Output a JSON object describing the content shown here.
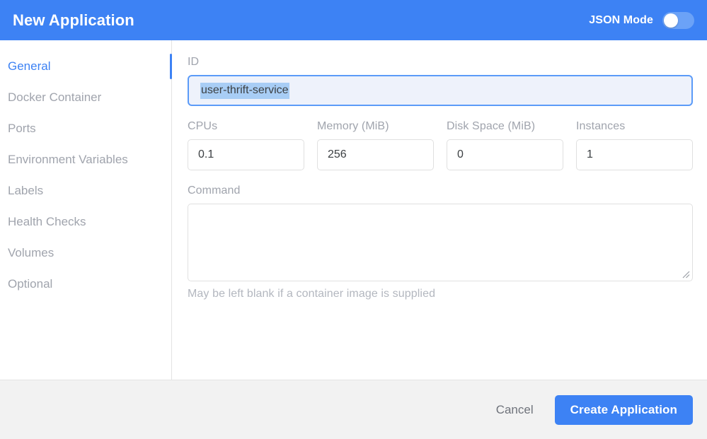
{
  "header": {
    "title": "New Application",
    "json_mode_label": "JSON Mode",
    "json_mode_on": false,
    "accent_color": "#3d82f4"
  },
  "sidebar": {
    "active_index": 0,
    "items": [
      {
        "label": "General"
      },
      {
        "label": "Docker Container"
      },
      {
        "label": "Ports"
      },
      {
        "label": "Environment Variables"
      },
      {
        "label": "Labels"
      },
      {
        "label": "Health Checks"
      },
      {
        "label": "Volumes"
      },
      {
        "label": "Optional"
      }
    ]
  },
  "form": {
    "id": {
      "label": "ID",
      "value": "user-thrift-service",
      "placeholder": "",
      "focused": true,
      "text_selected": true,
      "selection_color": "#a8cdf5",
      "focus_bg": "#eef2fb",
      "focus_border": "#5b9bf8"
    },
    "numeric_fields": [
      {
        "label": "CPUs",
        "value": "0.1",
        "placeholder": ""
      },
      {
        "label": "Memory (MiB)",
        "value": "256",
        "placeholder": ""
      },
      {
        "label": "Disk Space (MiB)",
        "value": "0",
        "placeholder": ""
      },
      {
        "label": "Instances",
        "value": "1",
        "placeholder": ""
      }
    ],
    "command": {
      "label": "Command",
      "value": "",
      "placeholder": "",
      "helper_text": "May be left blank if a container image is supplied"
    }
  },
  "footer": {
    "cancel_label": "Cancel",
    "create_label": "Create Application"
  }
}
